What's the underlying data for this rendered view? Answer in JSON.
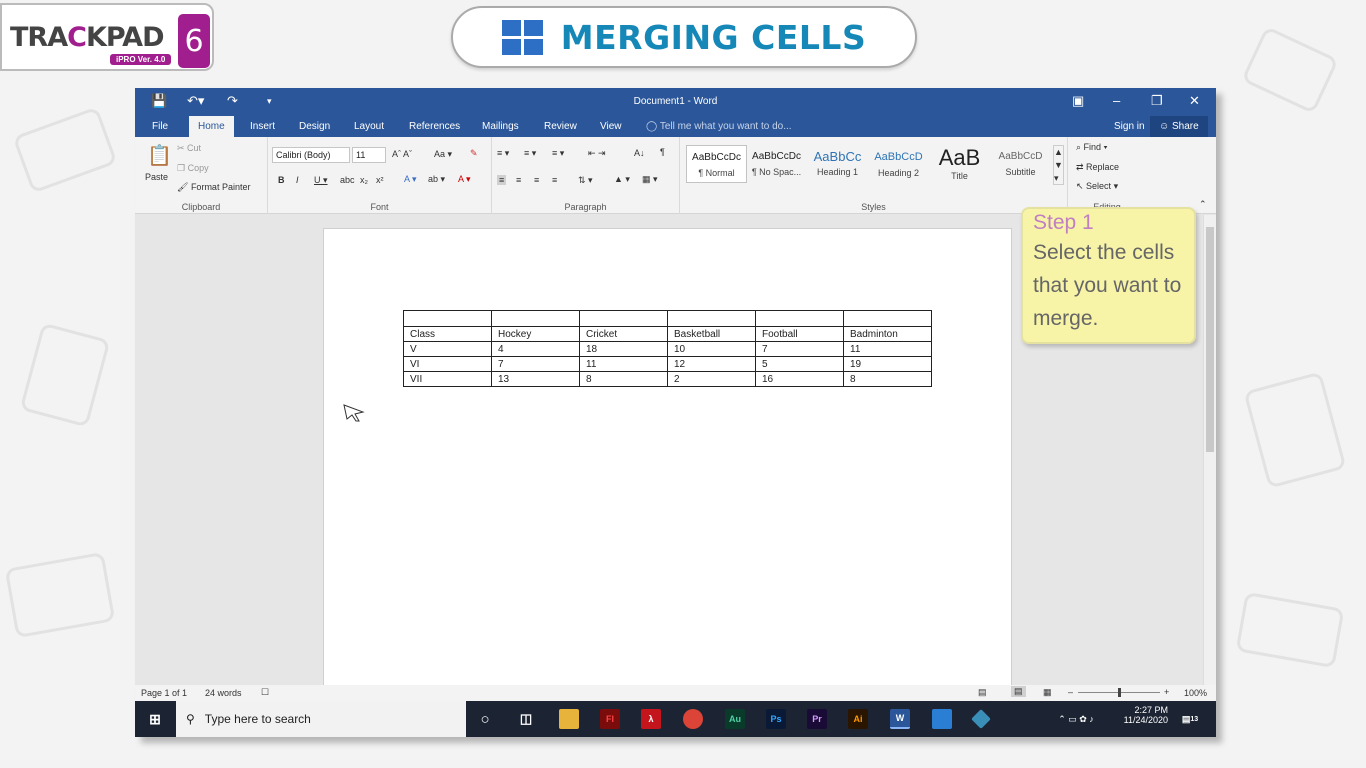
{
  "logo": {
    "word_pre": "TRA",
    "word_k": "C",
    "word_post": "KPAD",
    "version": "iPRO Ver. 4.0",
    "number": "6"
  },
  "banner": {
    "title": "MERGING CELLS"
  },
  "window": {
    "title": "Document1 - Word",
    "tabs": [
      "File",
      "Home",
      "Insert",
      "Design",
      "Layout",
      "References",
      "Mailings",
      "Review",
      "View"
    ],
    "tell_me": "Tell me what you want to do...",
    "sign_in": "Sign in",
    "share": "Share"
  },
  "ribbon": {
    "clipboard": {
      "paste": "Paste",
      "cut": "Cut",
      "copy": "Copy",
      "format_painter": "Format Painter",
      "label": "Clipboard"
    },
    "font": {
      "name": "Calibri (Body)",
      "size": "11",
      "label": "Font"
    },
    "paragraph": {
      "label": "Paragraph"
    },
    "styles": {
      "label": "Styles",
      "items": [
        {
          "sample": "AaBbCcDc",
          "name": "¶ Normal"
        },
        {
          "sample": "AaBbCcDc",
          "name": "¶ No Spac..."
        },
        {
          "sample": "AaBbCc",
          "name": "Heading 1"
        },
        {
          "sample": "AaBbCcD",
          "name": "Heading 2"
        },
        {
          "sample": "AaB",
          "name": "Title"
        },
        {
          "sample": "AaBbCcD",
          "name": "Subtitle"
        }
      ]
    },
    "editing": {
      "find": "Find",
      "replace": "Replace",
      "select": "Select",
      "label": "Editing"
    }
  },
  "table": {
    "rows": [
      [
        "",
        "",
        "",
        "",
        "",
        ""
      ],
      [
        "Class",
        "Hockey",
        "Cricket",
        "Basketball",
        "Football",
        "Badminton"
      ],
      [
        "V",
        "4",
        "18",
        "10",
        "7",
        "11"
      ],
      [
        "VI",
        "7",
        "11",
        "12",
        "5",
        "19"
      ],
      [
        "VII",
        "13",
        "8",
        "2",
        "16",
        "8"
      ]
    ]
  },
  "status": {
    "page": "Page 1 of 1",
    "words": "24 words",
    "zoom": "100%"
  },
  "taskbar": {
    "search_placeholder": "Type here to search",
    "time": "2:27 PM",
    "date": "11/24/2020",
    "notifications": "13"
  },
  "callout": {
    "step": "Step 1",
    "body": "Select the cells that you want to merge."
  },
  "colors": {
    "word_blue": "#2b579a",
    "brand_purple": "#a11e8f",
    "banner_teal": "#1688b7",
    "callout_yellow": "#f7f4a8"
  }
}
